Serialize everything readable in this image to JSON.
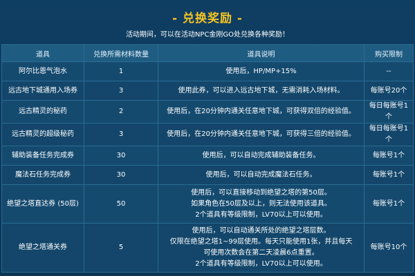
{
  "header": {
    "title": "- 兑换奖励 -",
    "subtitle": "活动期间，可以在活动NPC金刚GO处兑换各种奖励！"
  },
  "table": {
    "columns": [
      "道具",
      "兑换所需材料数量",
      "道具说明",
      "购买限制"
    ],
    "rows": [
      {
        "item": "阿尔比恩气泡水",
        "qty": "1",
        "desc": [
          "使用后，HP/MP+15%"
        ],
        "limit": "--"
      },
      {
        "item": "远古地下城通用入场券",
        "qty": "3",
        "desc": [
          "使用此券，可以进入远古地下城，无需消耗入场材料。"
        ],
        "limit": "每账号20个"
      },
      {
        "item": "远古精灵的秘药",
        "qty": "2",
        "desc": [
          "使用后，在20分钟内通关任意地下城，可获得双倍的经验值。"
        ],
        "limit": "每日每账号1个"
      },
      {
        "item": "远古精灵的超级秘药",
        "qty": "3",
        "desc": [
          "使用后，在20分钟内通关任意地下城，可获得三倍的经验值。"
        ],
        "limit": "每日每账号1个"
      },
      {
        "item": "辅助装备任务完成券",
        "qty": "30",
        "desc": [
          "使用后，可以自动完成辅助装备任务。"
        ],
        "limit": "每账号1个"
      },
      {
        "item": "魔法石任务完成券",
        "qty": "30",
        "desc": [
          "使用后，可以自动完成魔法石任务。"
        ],
        "limit": "每账号1个"
      },
      {
        "item": "绝望之塔直达券 (50层)",
        "qty": "50",
        "desc": [
          "使用后，可以直接移动到绝望之塔的第50层。",
          "如果角色在50层及以上，则无法使用该道具。",
          "2个道具有等级限制，LV70以上可以使用。"
        ],
        "limit": "每账号1个"
      },
      {
        "item": "绝望之塔通关券",
        "qty": "5",
        "desc": [
          "使用后，可以自动通关所处的绝望之塔层数。",
          "仅限在绝望之塔1~99层使用。每天只能使用1张，并且每天",
          "可使用次数会在第二天凌晨6点重置。",
          "2个道具有等级限制，LV70以上可以使用。"
        ],
        "limit": "每账号10个"
      }
    ]
  },
  "colors": {
    "background": "#0f3e63",
    "title": "#f6c524",
    "header_cell": "#1e5c82",
    "body_cell": "#154a6f",
    "grid": "#2a6c93"
  }
}
